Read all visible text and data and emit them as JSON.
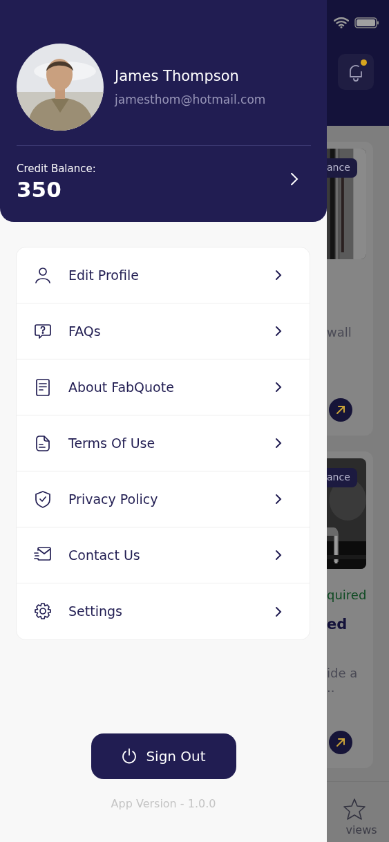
{
  "profile": {
    "name": "James Thompson",
    "email": "jamesthom@hotmail.com"
  },
  "credit": {
    "label": "Credit Balance:",
    "value": "350"
  },
  "menu": [
    {
      "kind": "profile",
      "label": "Edit Profile"
    },
    {
      "kind": "faq",
      "label": "FAQs"
    },
    {
      "kind": "about",
      "label": "About FabQuote"
    },
    {
      "kind": "terms",
      "label": "Terms Of Use"
    },
    {
      "kind": "privacy",
      "label": "Privacy Policy"
    },
    {
      "kind": "contact",
      "label": "Contact Us"
    },
    {
      "kind": "settings",
      "label": "Settings"
    }
  ],
  "sign_out": {
    "label": "Sign Out"
  },
  "app_version": "App Version - 1.0.0",
  "background": {
    "notification": {
      "unread": true
    },
    "cards": [
      {
        "badge": "ance",
        "lines": [
          {
            "kind": "body",
            "text": "wall"
          }
        ]
      },
      {
        "badge": "ance",
        "lines": [
          {
            "kind": "status",
            "text": "quired"
          },
          {
            "kind": "title",
            "text": "ed"
          },
          {
            "kind": "body",
            "text": "ide a"
          },
          {
            "kind": "body",
            "text": ".."
          }
        ]
      }
    ],
    "bottom_nav": {
      "label": "views"
    }
  }
}
